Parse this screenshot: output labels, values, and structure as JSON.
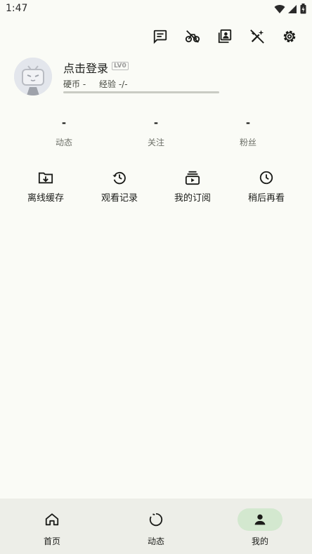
{
  "status_bar": {
    "time": "1:47",
    "icons": [
      "wifi-icon",
      "signal-icon",
      "battery-icon"
    ]
  },
  "top_actions": [
    "chat-icon",
    "no-bike-icon",
    "contacts-icon",
    "magic-off-icon",
    "settings-icon"
  ],
  "profile": {
    "login_text": "点击登录",
    "level_badge": "LV0",
    "coins": "硬币 -",
    "experience": "经验 -/-",
    "experience_progress": 0
  },
  "stats": [
    {
      "value": "-",
      "label": "动态"
    },
    {
      "value": "-",
      "label": "关注"
    },
    {
      "value": "-",
      "label": "粉丝"
    }
  ],
  "shortcuts": [
    {
      "label": "离线缓存",
      "icon": "folder-download-icon"
    },
    {
      "label": "观看记录",
      "icon": "history-icon"
    },
    {
      "label": "我的订阅",
      "icon": "subscriptions-icon"
    },
    {
      "label": "稍后再看",
      "icon": "watch-later-icon"
    }
  ],
  "bottom_nav": [
    {
      "label": "首页",
      "icon": "home-icon",
      "active": false
    },
    {
      "label": "动态",
      "icon": "dynamic-icon",
      "active": false
    },
    {
      "label": "我的",
      "icon": "person-icon",
      "active": true
    }
  ],
  "colors": {
    "background": "#fafbf6",
    "nav_background": "#edeee8",
    "active_pill": "#d3e8cf",
    "text": "#1b1c19"
  }
}
